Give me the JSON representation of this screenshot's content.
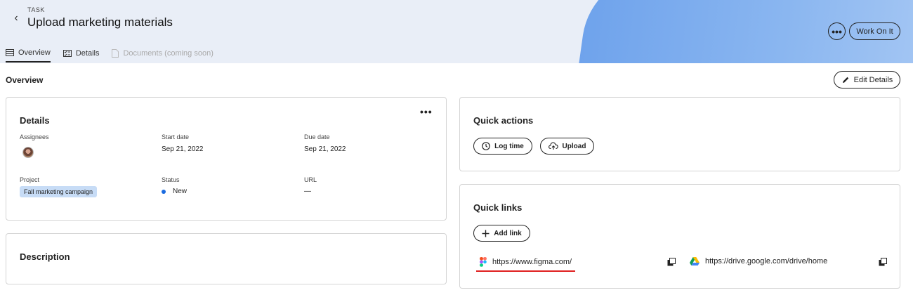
{
  "header": {
    "kicker": "TASK",
    "title": "Upload marketing materials",
    "tabs": [
      {
        "label": "Overview",
        "icon": "list-icon",
        "state": "active"
      },
      {
        "label": "Details",
        "icon": "checklist-icon",
        "state": "normal"
      },
      {
        "label": "Documents (coming soon)",
        "icon": "document-icon",
        "state": "disabled"
      }
    ],
    "work_on_it_label": "Work On It",
    "more_label": "•••"
  },
  "overview": {
    "title": "Overview",
    "edit_label": "Edit Details"
  },
  "details_card": {
    "title": "Details",
    "more_label": "•••",
    "assignees_label": "Assignees",
    "start_label": "Start date",
    "start_value": "Sep 21, 2022",
    "due_label": "Due date",
    "due_value": "Sep 21, 2022",
    "project_label": "Project",
    "project_value": "Fall marketing campaign",
    "status_label": "Status",
    "status_value": "New",
    "url_label": "URL",
    "url_value": "—"
  },
  "description_card": {
    "title": "Description"
  },
  "quick_actions": {
    "title": "Quick actions",
    "log_time_label": "Log time",
    "upload_label": "Upload"
  },
  "quick_links": {
    "title": "Quick links",
    "add_link_label": "Add link",
    "links": [
      {
        "url": "https://www.figma.com/",
        "icon": "figma-icon"
      },
      {
        "url": "https://drive.google.com/drive/home",
        "icon": "google-drive-icon"
      }
    ]
  },
  "colors": {
    "accent_blue": "#1a6be0",
    "chip_bg": "#c7dcf6",
    "underline_red": "#e02020"
  }
}
